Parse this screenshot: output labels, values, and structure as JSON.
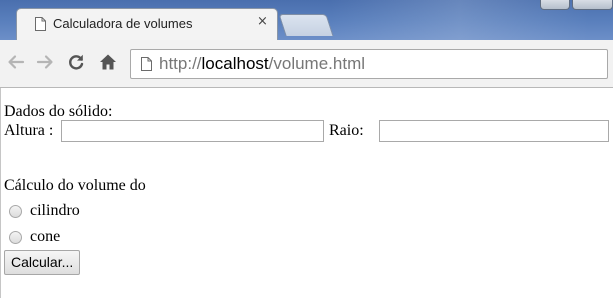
{
  "browser": {
    "tab": {
      "title": "Calculadora de volumes",
      "close_glyph": "×",
      "icon": "page-icon"
    },
    "nav": {
      "back_icon": "back-arrow-icon",
      "forward_icon": "forward-arrow-icon",
      "reload_icon": "reload-icon",
      "home_icon": "home-icon"
    },
    "address": {
      "scheme": "http://",
      "host": "localhost",
      "path": "/volume.html",
      "icon": "page-icon"
    },
    "colors": {
      "frame": "#5a80bd",
      "toolbar": "#f2f2f2"
    }
  },
  "form": {
    "heading": "Dados do sólido:",
    "altura_label": "Altura :",
    "altura_value": "",
    "raio_label": "Raio:",
    "raio_value": "",
    "volume_heading": "Cálculo do volume do",
    "options": [
      {
        "label": "cilindro",
        "checked": false
      },
      {
        "label": "cone",
        "checked": false
      }
    ],
    "submit_label": "Calcular..."
  }
}
